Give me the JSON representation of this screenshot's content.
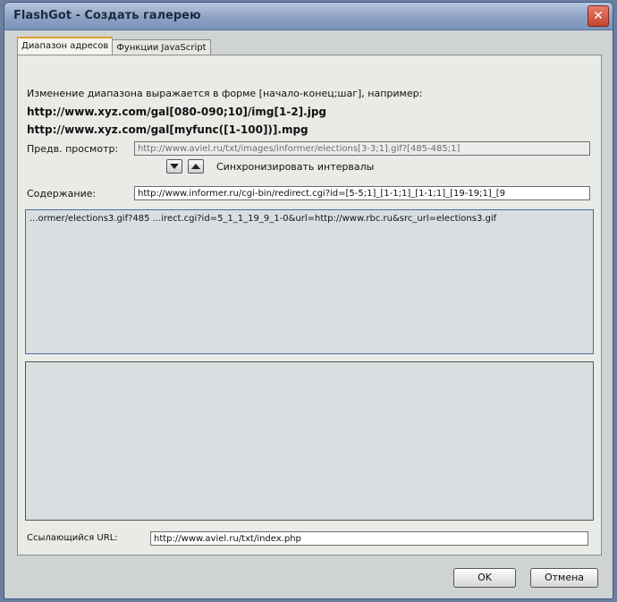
{
  "window": {
    "title": "FlashGot - Создать галерею",
    "close_label": "✕"
  },
  "tabs": [
    {
      "label": "Диапазон адресов",
      "active": true
    },
    {
      "label": "Функции JavaScript",
      "active": false
    }
  ],
  "help": {
    "text": "Изменение диапазона выражается в форме [начало-конец;шаг], например:",
    "example1": "http://www.xyz.com/gal[080-090;10]/img[1-2].jpg",
    "example2": "http://www.xyz.com/gal[myfunc([1-100])].mpg"
  },
  "preview": {
    "label": "Предв. просмотр:",
    "value": "http://www.aviel.ru/txt/images/informer/elections[3-3;1].gif?[485-485;1]"
  },
  "sync": {
    "label": "Синхронизировать интервалы"
  },
  "content": {
    "label": "Содержание:",
    "value": "http://www.informer.ru/cgi-bin/redirect.cgi?id=[5-5;1]_[1-1;1]_[1-1;1]_[19-19;1]_[9"
  },
  "results": {
    "line": "...ormer/elections3.gif?485  ...irect.cgi?id=5_1_1_19_9_1-0&url=http://www.rbc.ru&src_url=elections3.gif"
  },
  "referrer": {
    "label": "Ссылающийся URL:",
    "value": "http://www.aviel.ru/txt/index.php"
  },
  "buttons": {
    "ok": "OK",
    "cancel": "Отмена"
  }
}
